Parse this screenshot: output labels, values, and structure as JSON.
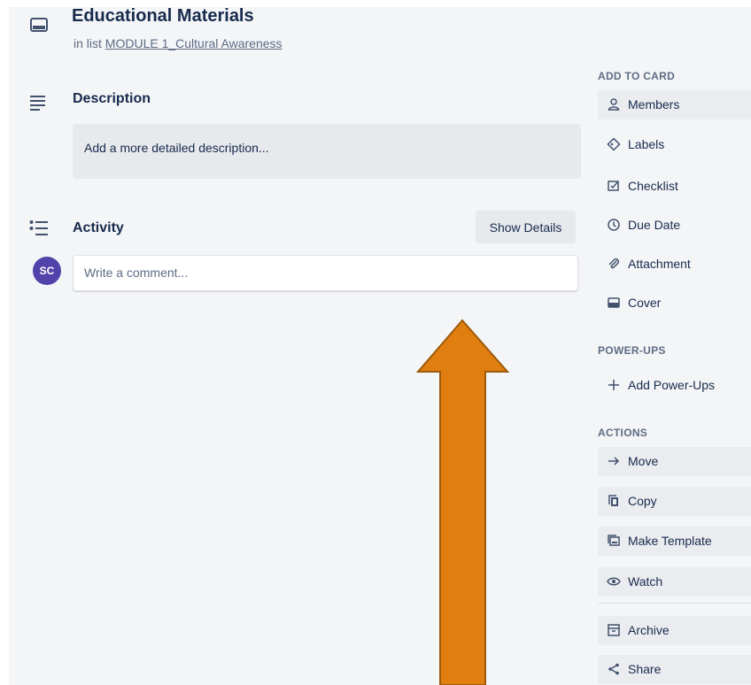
{
  "card": {
    "title": "Educational Materials",
    "in_list_prefix": "in list",
    "list_name": "MODULE 1_Cultural Awareness"
  },
  "description": {
    "heading": "Description",
    "placeholder": "Add a more detailed description..."
  },
  "activity": {
    "heading": "Activity",
    "show_details_label": "Show Details",
    "avatar_initials": "SC",
    "comment_placeholder": "Write a comment..."
  },
  "sidebar": {
    "add_to_card": {
      "heading": "ADD TO CARD",
      "items": [
        {
          "label": "Members",
          "icon": "person-icon"
        },
        {
          "label": "Labels",
          "icon": "tag-icon"
        },
        {
          "label": "Checklist",
          "icon": "checkbox-icon"
        },
        {
          "label": "Due Date",
          "icon": "clock-icon"
        },
        {
          "label": "Attachment",
          "icon": "paperclip-icon"
        },
        {
          "label": "Cover",
          "icon": "cover-icon"
        }
      ]
    },
    "power_ups": {
      "heading": "POWER-UPS",
      "add_label": "Add Power-Ups"
    },
    "actions": {
      "heading": "ACTIONS",
      "items": [
        {
          "label": "Move",
          "icon": "arrow-right-icon"
        },
        {
          "label": "Copy",
          "icon": "copy-icon"
        },
        {
          "label": "Make Template",
          "icon": "template-icon"
        },
        {
          "label": "Watch",
          "icon": "eye-icon"
        },
        {
          "label": "Archive",
          "icon": "archive-icon"
        },
        {
          "label": "Share",
          "icon": "share-icon"
        }
      ]
    }
  },
  "colors": {
    "panel_background": "#f4f5f7",
    "button_background": "#ebecf0",
    "text_primary": "#172b4d",
    "text_secondary": "#5e6c84",
    "avatar": "#5243aa",
    "annotation_arrow_fill": "#e07f10",
    "annotation_arrow_stroke": "#9c5a0a"
  }
}
